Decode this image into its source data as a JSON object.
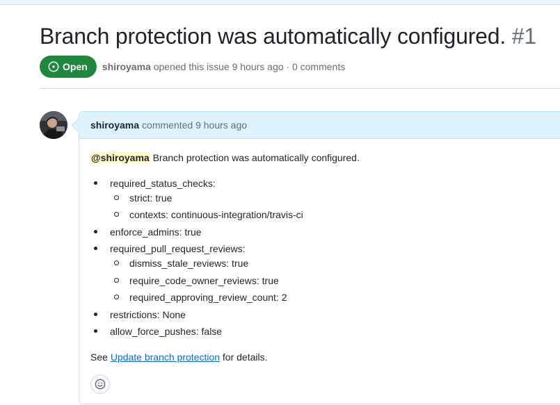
{
  "issue": {
    "title": "Branch protection was automatically configured.",
    "number": "#1",
    "state": "Open",
    "state_color": "#1f883d",
    "author": "shiroyama",
    "opened_text": "opened this issue 9 hours ago · 0 comments"
  },
  "comment": {
    "author": "shiroyama",
    "meta": "commented 9 hours ago",
    "mention": "@shiroyama",
    "intro": " Branch protection was automatically configured.",
    "items": [
      {
        "label": "required_status_checks:",
        "children": [
          "strict: true",
          "contexts: continuous-integration/travis-ci"
        ]
      },
      {
        "label": "enforce_admins: true",
        "children": []
      },
      {
        "label": "required_pull_request_reviews:",
        "children": [
          "dismiss_stale_reviews: true",
          "require_code_owner_reviews: true",
          "required_approving_review_count: 2"
        ]
      },
      {
        "label": "restrictions: None",
        "children": []
      },
      {
        "label": "allow_force_pushes: false",
        "children": []
      }
    ],
    "footer_prefix": "See ",
    "footer_link": "Update branch protection",
    "footer_suffix": " for details."
  },
  "icons": {
    "state": "issue-opened-icon",
    "reaction": "smiley-icon",
    "avatar": "user-avatar"
  }
}
